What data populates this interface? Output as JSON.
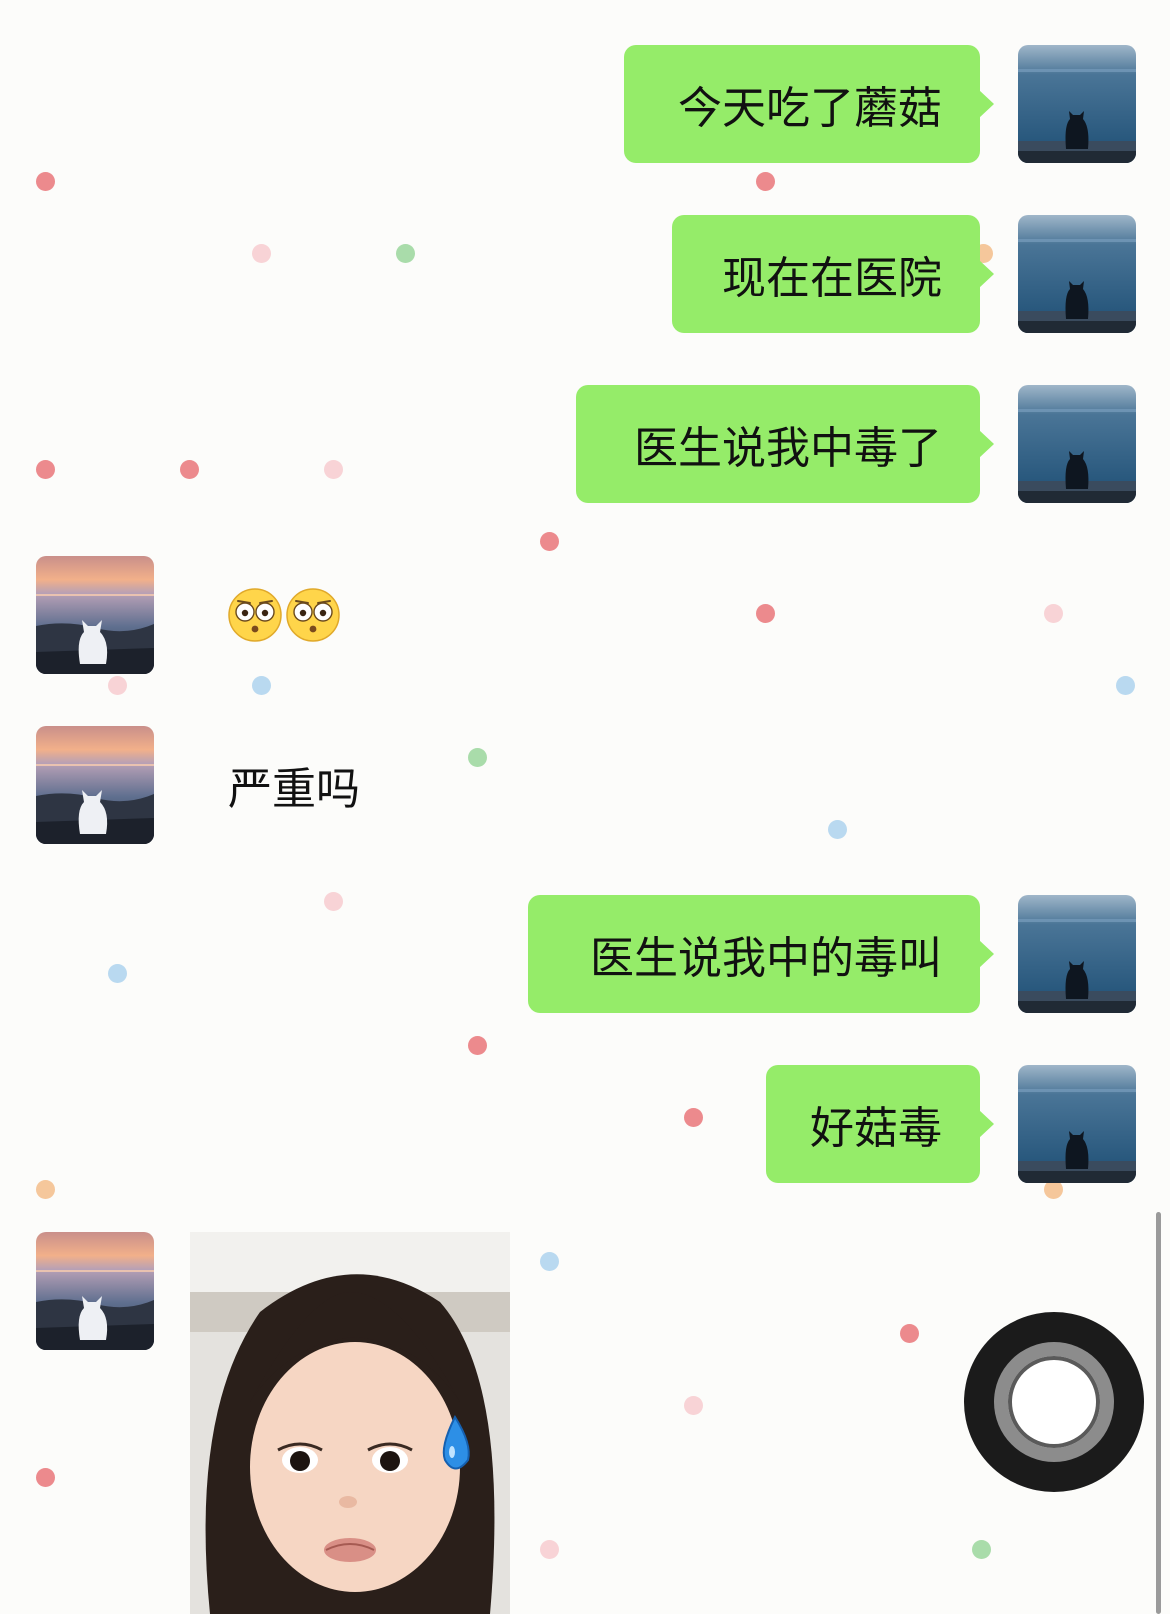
{
  "colors": {
    "background": "#fcfcfa",
    "sent_bubble": "#95ec69",
    "text": "#111111"
  },
  "messages": [
    {
      "side": "right",
      "type": "text",
      "text": "今天吃了蘑菇"
    },
    {
      "side": "right",
      "type": "text",
      "text": "现在在医院"
    },
    {
      "side": "right",
      "type": "text",
      "text": "医生说我中毒了"
    },
    {
      "side": "left",
      "type": "emoji",
      "icon": "flushed-face-emoji"
    },
    {
      "side": "left",
      "type": "text",
      "text": "严重吗"
    },
    {
      "side": "right",
      "type": "text",
      "text": "医生说我中的毒叫"
    },
    {
      "side": "right",
      "type": "text",
      "text": "好菇毒"
    },
    {
      "side": "left",
      "type": "sticker",
      "icon": "crying-girl-sticker"
    }
  ],
  "avatars": {
    "self": "cat-by-blue-sea-avatar",
    "other": "white-cat-sunset-avatar"
  },
  "overlay": {
    "icon": "assistive-touch-button"
  }
}
